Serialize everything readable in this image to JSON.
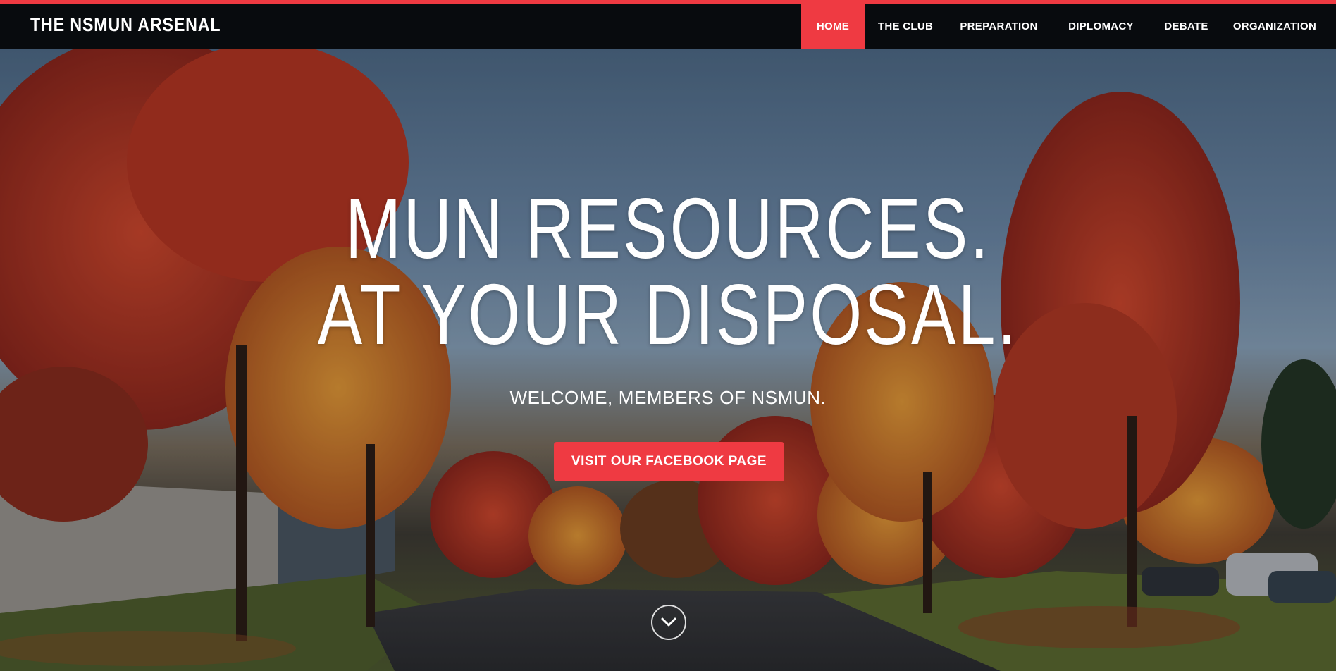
{
  "brand": {
    "title": "THE NSMUN ARSENAL"
  },
  "nav": {
    "items": [
      {
        "label": "HOME",
        "active": true
      },
      {
        "label": "THE CLUB",
        "active": false
      },
      {
        "label": "PREPARATION",
        "active": false
      },
      {
        "label": "DIPLOMACY",
        "active": false
      },
      {
        "label": "DEBATE",
        "active": false
      },
      {
        "label": "ORGANIZATION",
        "active": false
      }
    ]
  },
  "hero": {
    "headline_line1": "MUN RESOURCES.",
    "headline_line2": "AT YOUR DISPOSAL.",
    "subtitle": "WELCOME, MEMBERS OF NSMUN.",
    "cta_label": "VISIT OUR FACEBOOK PAGE",
    "scroll_icon": "chevron-down-circle-icon",
    "background_subject": "autumn-trees-road-photo"
  },
  "colors": {
    "accent": "#ef3a42",
    "navbar_bg": "#080b0e",
    "text": "#ffffff"
  }
}
